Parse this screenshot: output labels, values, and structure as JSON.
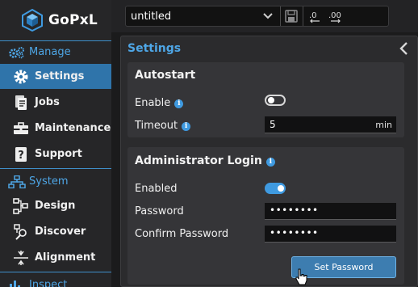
{
  "brand": {
    "name": "GoPxL"
  },
  "sidebar": {
    "groups": [
      {
        "label": "Manage",
        "icon": "gears-icon"
      },
      {
        "label": "System",
        "icon": "hierarchy-icon"
      },
      {
        "label": "Inspect",
        "icon": "bar-chart-icon"
      }
    ],
    "items": [
      {
        "label": "Settings",
        "icon": "gear-icon",
        "active": true
      },
      {
        "label": "Jobs",
        "icon": "document-icon"
      },
      {
        "label": "Maintenance",
        "icon": "toolbox-icon"
      },
      {
        "label": "Support",
        "icon": "help-book-icon"
      },
      {
        "label": "Design",
        "icon": "flow-icon"
      },
      {
        "label": "Discover",
        "icon": "search-network-icon"
      },
      {
        "label": "Alignment",
        "icon": "align-icon"
      }
    ]
  },
  "topbar": {
    "project": "untitled",
    "icons": [
      "save-icon",
      "decimal-decrease-icon",
      "decimal-increase-icon"
    ]
  },
  "panel": {
    "title": "Settings",
    "autostart": {
      "title": "Autostart",
      "enable_label": "Enable",
      "enable_value": false,
      "timeout_label": "Timeout",
      "timeout_value": "5",
      "timeout_unit": "min"
    },
    "admin": {
      "title": "Administrator Login",
      "enabled_label": "Enabled",
      "enabled_value": true,
      "password_label": "Password",
      "password_value": "••••••••",
      "confirm_label": "Confirm Password",
      "confirm_value": "••••••••",
      "set_password_label": "Set Password"
    }
  },
  "colors": {
    "accent": "#4ea6e6",
    "active_nav": "#2f74aa",
    "button": "#3d7db0"
  }
}
